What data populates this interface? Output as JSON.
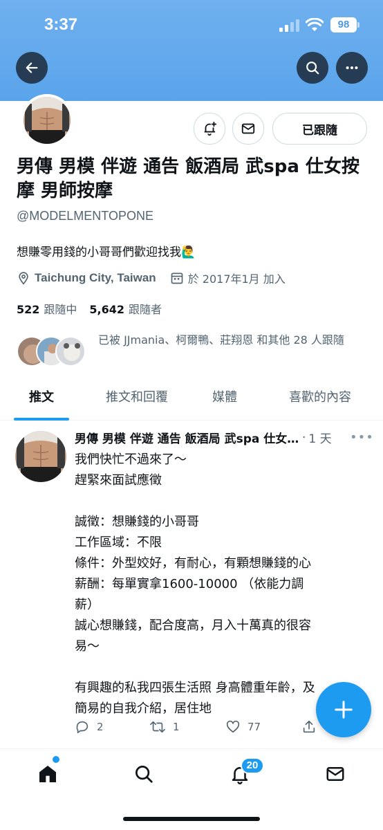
{
  "status_bar": {
    "time": "3:37",
    "battery": "98"
  },
  "profile": {
    "display_name": "男傳 男模 伴遊 通告 飯酒局 武spa 仕女按摩 男師按摩",
    "handle": "@MODELMENTOPONE",
    "bio": "想賺零用錢的小哥哥們歡迎找我🙋‍♂️",
    "location": "Taichung City, Taiwan",
    "joined": "於 2017年1月 加入",
    "following_count": "522",
    "following_label": "跟隨中",
    "followers_count": "5,642",
    "followers_label": "跟隨者",
    "followed_by": "已被 JJmania、柯爾鴨、莊翔恩 和其他 28 人跟隨",
    "follow_button": "已跟隨"
  },
  "tabs": [
    {
      "label": "推文",
      "active": true
    },
    {
      "label": "推文和回覆",
      "active": false
    },
    {
      "label": "媒體",
      "active": false
    },
    {
      "label": "喜歡的內容",
      "active": false
    }
  ],
  "tweet": {
    "author": "男傳 男模 伴遊 通告 飯酒局 武spa 仕女按摩 男師按摩",
    "time": "1 天",
    "lines": [
      "我們快忙不過來了～",
      "趕緊來面試應徵",
      "",
      "誠徵：想賺錢的小哥哥",
      "工作區域：不限",
      "條件：外型姣好，有耐心，有顆想賺錢的心",
      "薪酬：每單實拿1600-10000 （依能力調",
      "薪）",
      "誠心想賺錢，配合度高，月入十萬真的很容",
      "易～",
      "",
      "有興趣的私我四張生活照 身高體重年齡，及",
      "簡易的自我介紹，居住地"
    ],
    "replies": "2",
    "retweets": "1",
    "likes": "77"
  },
  "bottom_nav": {
    "notification_badge": "20"
  },
  "colors": {
    "accent": "#1d9bf0",
    "banner": "#5aa4ec",
    "text_secondary": "#536471"
  }
}
